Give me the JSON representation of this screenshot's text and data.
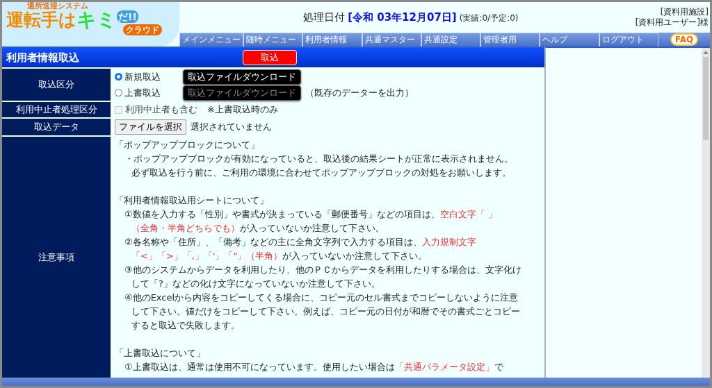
{
  "logo": {
    "tagline": "通所送迎システム",
    "main": "運転手は",
    "accent": "キミ",
    "exclaim": "だ!!",
    "cloud": "クラウド"
  },
  "header": {
    "date_label": "処理日付",
    "date_value": "[令和 03年12月07日]",
    "counts": "(実績:0/予定:0)",
    "facility": "[資料用施設]",
    "user": "[資料用ユーザー]様"
  },
  "nav": [
    {
      "label": "メインメニュー"
    },
    {
      "label": "随時メニュー"
    },
    {
      "label": "利用者情報"
    },
    {
      "label": "共通マスター"
    },
    {
      "label": "共通設定"
    },
    {
      "label": "管理者用"
    },
    {
      "label": "ヘルプ"
    },
    {
      "label": "ログアウト"
    }
  ],
  "faq": "FAQ",
  "page_title": "利用者情報取込",
  "submit_button": "取込",
  "form": {
    "import_type": {
      "label": "取込区分",
      "options": [
        {
          "label": "新規取込",
          "selected": true,
          "download": {
            "label": "取込ファイルダウンロード",
            "disabled": false
          }
        },
        {
          "label": "上書取込",
          "selected": false,
          "download": {
            "label": "取込ファイルダウンロード",
            "disabled": true
          },
          "note": "（既存のデーターを出力）"
        }
      ]
    },
    "suspended": {
      "label": "利用中止者処理区分",
      "checkbox": {
        "label": "利用中止者も含む",
        "checked": false,
        "disabled": true
      },
      "note": "※上書取込時のみ"
    },
    "data": {
      "label": "取込データ",
      "button": "ファイルを選択",
      "status": "選択されていません"
    },
    "notes": {
      "label": "注意事項",
      "blocks": [
        {
          "kind": "heading",
          "text": "「ポップアップブロックについて」"
        },
        {
          "kind": "item",
          "lines": [
            [
              {
                "text": "・ポップアップブロックが有効になっていると、取込後の結果シートが正常に表示されません。",
                "emphasis": false
              }
            ],
            [
              {
                "text": "必ず取込を行う前に、ご利用の環境に合わせてポップアップブロックの対処をお願いします。",
                "emphasis": false
              }
            ]
          ]
        },
        {
          "kind": "blank"
        },
        {
          "kind": "heading",
          "text": "「利用者情報取込用シートについて」"
        },
        {
          "kind": "item",
          "lines": [
            [
              {
                "text": "①数値を入力する「性別」や書式が決まっている「郵便番号」などの項目は、",
                "emphasis": false
              },
              {
                "text": "空白文字「 」",
                "emphasis": true
              }
            ],
            [
              {
                "text": "（全角・半角どちらでも）",
                "emphasis": true
              },
              {
                "text": "が入っていないか注意して下さい。",
                "emphasis": false
              }
            ]
          ]
        },
        {
          "kind": "item",
          "lines": [
            [
              {
                "text": "②各名称や「住所」、「備考」などの主に全角文字列で入力する項目は、",
                "emphasis": false
              },
              {
                "text": "入力規制文字",
                "emphasis": true
              }
            ],
            [
              {
                "text": "「<」「>」「,」「'」「\"」（半角）",
                "emphasis": true
              },
              {
                "text": "が入っていないか注意して下さい。",
                "emphasis": false
              }
            ]
          ]
        },
        {
          "kind": "item",
          "lines": [
            [
              {
                "text": "③他のシステムからデータを利用したり、他のＰＣからデータを利用したりする場合は、文字化け",
                "emphasis": false
              }
            ],
            [
              {
                "text": "して「?」などの化け文字になっていないか注意して下さい。",
                "emphasis": false
              }
            ]
          ]
        },
        {
          "kind": "item",
          "lines": [
            [
              {
                "text": "④他のExcelから内容をコピーしてくる場合に、コピー元のセル書式までコピーしないように注意",
                "emphasis": false
              }
            ],
            [
              {
                "text": "して下さい。値だけをコピーして下さい。例えば、コピー元の日付が和暦でその書式ごとコピー",
                "emphasis": false
              }
            ],
            [
              {
                "text": "すると取込で失敗します。",
                "emphasis": false
              }
            ]
          ]
        },
        {
          "kind": "blank"
        },
        {
          "kind": "heading",
          "text": "「上書取込について」"
        },
        {
          "kind": "item",
          "lines": [
            [
              {
                "text": "①上書取込は、通常は使用不可になっています。使用したい場合は",
                "emphasis": false
              },
              {
                "text": "「共通パラメータ設定」",
                "emphasis": true
              },
              {
                "text": "で",
                "emphasis": false
              }
            ]
          ]
        }
      ]
    }
  }
}
